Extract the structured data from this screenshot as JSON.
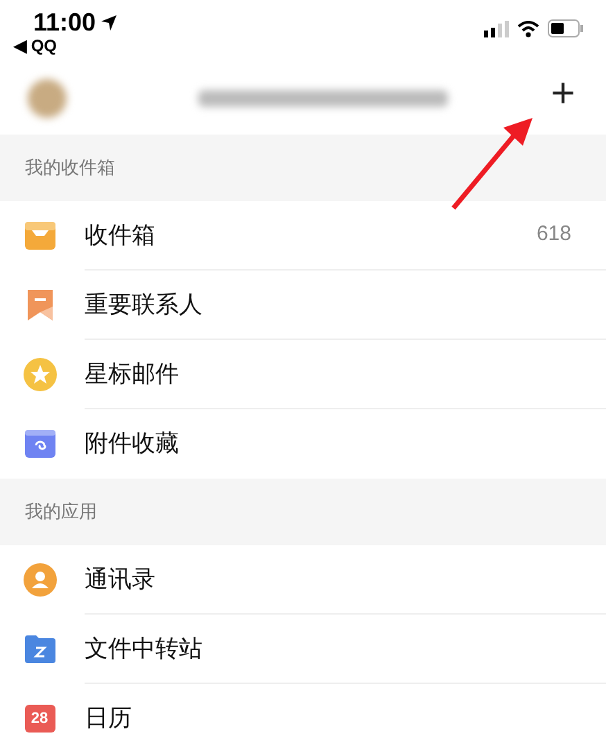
{
  "status_bar": {
    "time": "11:00",
    "back_app": "◀ QQ"
  },
  "header": {
    "add_button": "+"
  },
  "sections": [
    {
      "title": "我的收件箱",
      "items": [
        {
          "kind": "inbox",
          "label": "收件箱",
          "count": "618"
        },
        {
          "kind": "vip",
          "label": "重要联系人"
        },
        {
          "kind": "star",
          "label": "星标邮件"
        },
        {
          "kind": "attachment",
          "label": "附件收藏"
        }
      ]
    },
    {
      "title": "我的应用",
      "items": [
        {
          "kind": "contacts",
          "label": "通讯录"
        },
        {
          "kind": "folder",
          "label": "文件中转站"
        },
        {
          "kind": "calendar",
          "label": "日历",
          "icon_text": "28"
        }
      ]
    }
  ]
}
